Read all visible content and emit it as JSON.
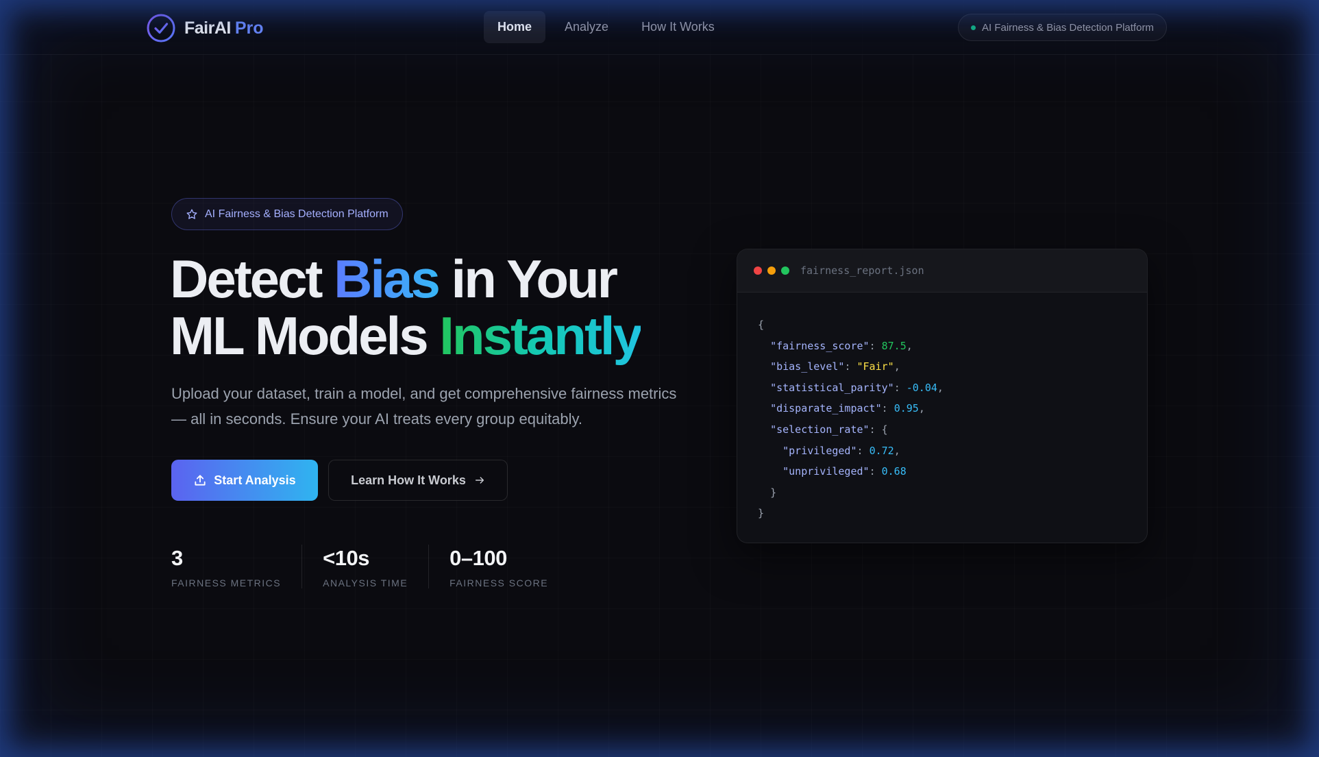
{
  "brand": {
    "name": "FairAI",
    "suffix": "Pro"
  },
  "nav": {
    "items": [
      {
        "label": "Home",
        "active": true
      },
      {
        "label": "Analyze",
        "active": false
      },
      {
        "label": "How It Works",
        "active": false
      }
    ],
    "status_pill": "AI Fairness & Bias Detection Platform"
  },
  "hero": {
    "badge": "AI Fairness & Bias Detection Platform",
    "headline": {
      "part1": "Detect ",
      "highlight1": "Bias",
      "part2": " in Your",
      "part3": "ML Models ",
      "highlight2": "Instantly"
    },
    "subtext": "Upload your dataset, train a model, and get comprehensive fairness metrics — all in seconds. Ensure your AI treats every group equitably.",
    "primary_button": "Start Analysis",
    "secondary_button": "Learn How It Works"
  },
  "stats": [
    {
      "value": "3",
      "label": "Fairness Metrics"
    },
    {
      "value": "<10s",
      "label": "Analysis Time"
    },
    {
      "value": "0–100",
      "label": "Fairness Score"
    }
  ],
  "code_window": {
    "filename": "fairness_report.json",
    "lines": {
      "open": "{",
      "fairness_score_key": "\"fairness_score\"",
      "fairness_score_val": "87.5",
      "bias_level_key": "\"bias_level\"",
      "bias_level_val": "\"Fair\"",
      "statistical_parity_key": "\"statistical_parity\"",
      "statistical_parity_val": "-0.04",
      "disparate_impact_key": "\"disparate_impact\"",
      "disparate_impact_val": "0.95",
      "selection_rate_key": "\"selection_rate\"",
      "privileged_key": "\"privileged\"",
      "privileged_val": "0.72",
      "unprivileged_key": "\"unprivileged\"",
      "unprivileged_val": "0.68",
      "inner_close": "}",
      "close": "}"
    }
  },
  "colors": {
    "accent_blue": "#5b7cff",
    "accent_cyan": "#38b6f7",
    "accent_green": "#22c55e",
    "background": "#0b0b10",
    "status_green": "#10b981",
    "window_red": "#ef4444",
    "window_yellow": "#f59e0b",
    "window_green": "#22c55e"
  }
}
